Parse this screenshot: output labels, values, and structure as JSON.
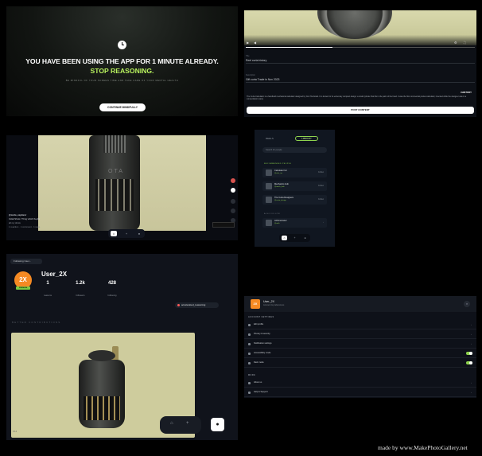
{
  "usage_warning": {
    "headline": "YOU HAVE BEEN USING THE APP FOR 1 MINUTE ALREADY.",
    "accent": "STOP REASONING.",
    "subtext": "BE MINDFUL OF YOUR SCREEN TIME AND TAKE CARE OF YOUR MENTAL HEALTH",
    "cta_label": "CONTINUE MINDFULLY"
  },
  "video_form": {
    "field1_label": "Title",
    "field1_value": "Reel curta history",
    "field2_label": "Description",
    "field2_value": "Gift curta Trade in Nov 2023",
    "tag": "#HISTORY",
    "description": "The Curta Calculator is a handheld mechanical calculator designed by Curt Herzstark. It is known for its extremely compact design: a small cylinder that fits in the palm of the hand. It was the first commercial pocket calculator, invented while the designer was in a concentration camp.",
    "submit_label": "POST CONTENT"
  },
  "reel": {
    "engraving": "OTA",
    "author": "@curta_explorer",
    "caption": "Initial Shots: Thing which Keyfix",
    "sub": "all my shots",
    "meta": "1 reaction  ·  1 comment  ·  1 save"
  },
  "search_list": {
    "tab_left": "REELS",
    "tab_right": "LIBRARY",
    "search_placeholder": "Search for people",
    "section1": "RECOMMENDED PEOPLE",
    "items": [
      {
        "name": "Calculator Inc",
        "handle": "@calc_inc",
        "action": "Follow"
      },
      {
        "name": "Mechanics Hub",
        "handle": "@mech_hub",
        "action": "Follow"
      },
      {
        "name": "The Curta Designers",
        "handle": "@curta_design",
        "action": "Follow"
      }
    ],
    "section2": "ALSO FOLLOW",
    "extra_item": {
      "name": "Arithmometer",
      "handle": "@arith",
      "action": "›"
    }
  },
  "profile": {
    "following_label": "Following User...",
    "avatar_text": "2X",
    "badge": "PREMIUM",
    "username": "User_2X",
    "stats": [
      {
        "value": "1",
        "label": "reasons"
      },
      {
        "value": "1.2k",
        "label": "followers"
      },
      {
        "value": "428",
        "label": "following"
      }
    ],
    "pill": "accelerated_reasoning",
    "section_title": "BETTER CONTRIBUTIONS",
    "corner": "0:14"
  },
  "settings": {
    "avatar": "2X",
    "name": "User_2X",
    "subtitle": "Account & preferences",
    "section1": "ACCOUNT SETTINGS",
    "rows": [
      {
        "label": "Edit profile",
        "trail": "›"
      },
      {
        "label": "Privacy & security",
        "trail": "›"
      },
      {
        "label": "Notification settings",
        "trail": "›"
      },
      {
        "label": "Accessibility mode",
        "toggle": true
      },
      {
        "label": "Dark mode",
        "toggle": true
      }
    ],
    "section2": "MORE",
    "more_rows": [
      {
        "label": "About us",
        "trail": "›"
      },
      {
        "label": "Help & Support",
        "trail": "›"
      }
    ]
  },
  "credit": "made by www.MakePhotoGallery.net",
  "colors": {
    "accent_green": "#b8f25e",
    "avatar_orange": "#f58a23",
    "badge_green": "#7ac943"
  }
}
